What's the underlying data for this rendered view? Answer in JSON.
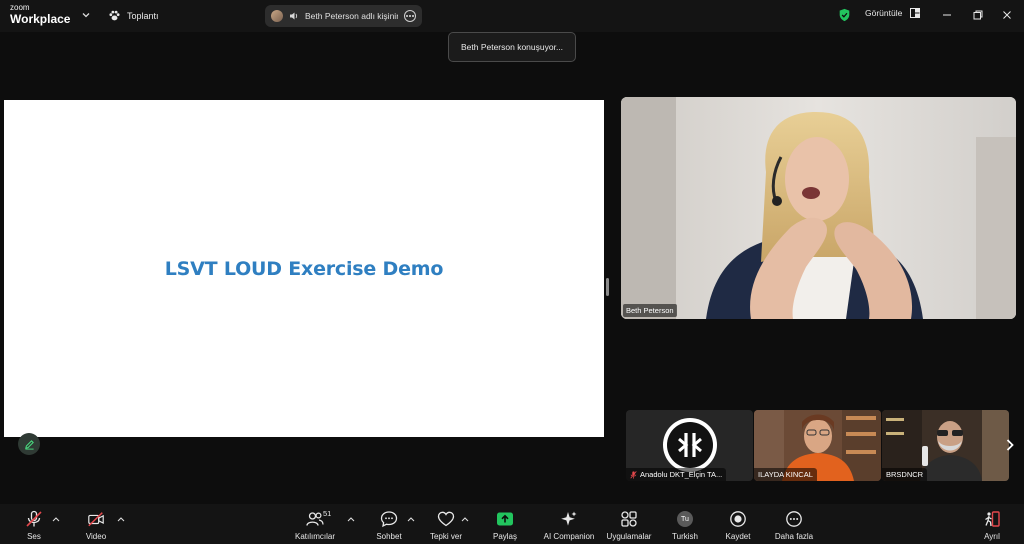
{
  "app": {
    "brand_small": "zoom",
    "brand_big": "Workplace"
  },
  "header": {
    "meeting_label": "Toplantı",
    "active_speaker_pill": "Beth Peterson adlı kişinin ek",
    "view_label": "Görüntüle"
  },
  "tooltip": {
    "text": "Beth Peterson konuşuyor..."
  },
  "slide": {
    "title": "LSVT LOUD Exercise Demo"
  },
  "main_video": {
    "name": "Beth Peterson"
  },
  "filmstrip": [
    {
      "name": "Anadolu DKT_Elçin TA...",
      "muted": true
    },
    {
      "name": "ILAYDA KINCAL",
      "muted": false
    },
    {
      "name": "BRSDNCR",
      "muted": false
    }
  ],
  "toolbar": {
    "audio": "Ses",
    "video": "Video",
    "participants": "Katılımcılar",
    "participants_count": "51",
    "chat": "Sohbet",
    "reactions": "Tepki ver",
    "share": "Paylaş",
    "ai": "AI Companion",
    "apps": "Uygulamalar",
    "language": "Turkish",
    "language_code": "Tu",
    "record": "Kaydet",
    "more": "Daha fazla",
    "leave": "Ayrıl"
  },
  "colors": {
    "share_green": "#22c55e",
    "slide_title": "#2f7fc1",
    "shield_green": "#22c55e",
    "leave_red": "#e5484d"
  }
}
